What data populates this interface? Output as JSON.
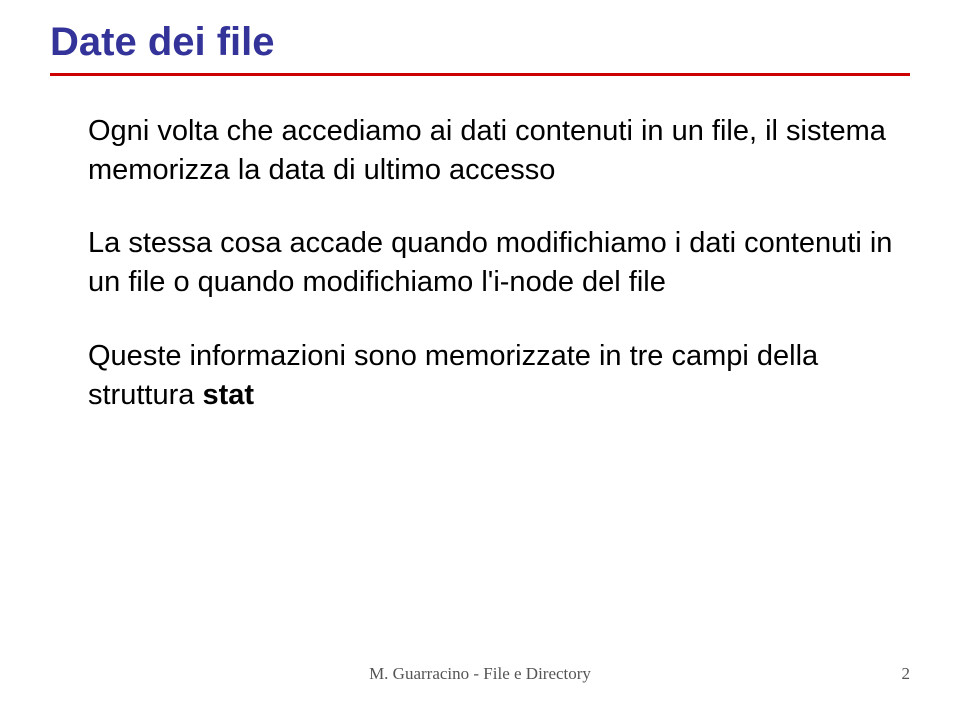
{
  "slide": {
    "title": "Date dei file",
    "paragraphs": [
      "Ogni volta che accediamo ai dati contenuti in un file, il sistema memorizza la data di ultimo accesso",
      "La stessa cosa accade quando modifichiamo i dati contenuti in un file o quando modifichiamo l'i-node del file"
    ],
    "paragraph3_prefix": "Queste informazioni sono memorizzate in tre campi della struttura ",
    "paragraph3_bold": "stat"
  },
  "footer": {
    "text": "M. Guarracino - File e Directory",
    "page": "2"
  }
}
